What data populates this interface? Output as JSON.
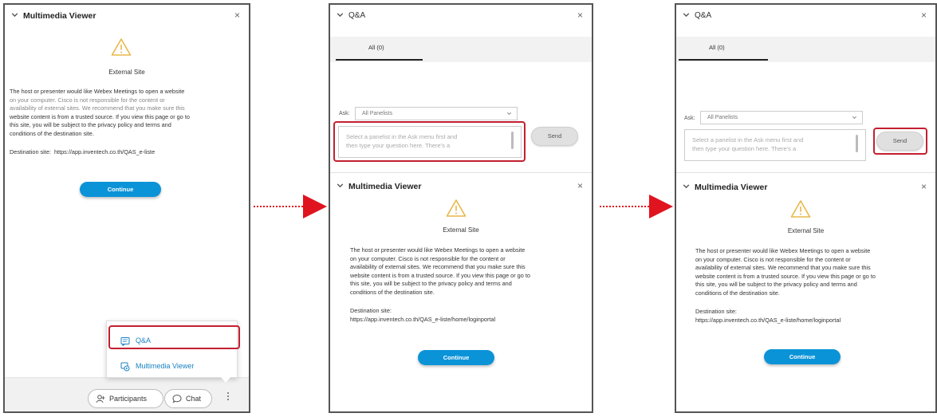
{
  "multimedia": {
    "title": "Multimedia Viewer",
    "site_heading": "External Site",
    "body_lines": [
      "The host or presenter would like Webex Meetings to open a website",
      "on your computer. Cisco is not responsible for the content or",
      "availability of external sites. We recommend that you make sure this",
      "website content is from a trusted source. If you view this page or go to",
      "this site, you will be subject to the privacy policy and terms and",
      "conditions of the destination site."
    ],
    "destination_label": "Destination site:",
    "destination_url_short": "https://app.inventech.co.th/QAS_e-liste",
    "destination_url_full": "https://app.inventech.co.th/QAS_e-liste/home/loginportal",
    "continue_label": "Continue"
  },
  "popup_menu": {
    "items": [
      {
        "label": "Q&A",
        "icon": "qa-icon"
      },
      {
        "label": "Multimedia Viewer",
        "icon": "multimedia-icon"
      }
    ]
  },
  "footer": {
    "participants_label": "Participants",
    "chat_label": "Chat"
  },
  "qa": {
    "title": "Q&A",
    "tab_all": "All (0)",
    "ask_label": "Ask:",
    "ask_value": "All Panelists",
    "question_placeholder_lines": [
      "Select a panelist in the Ask menu first and",
      "then type your question here. There's a"
    ],
    "send_label": "Send"
  },
  "colors": {
    "highlight": "#c32030",
    "continue_button": "#0b93d8",
    "arrow": "#e0141e"
  }
}
